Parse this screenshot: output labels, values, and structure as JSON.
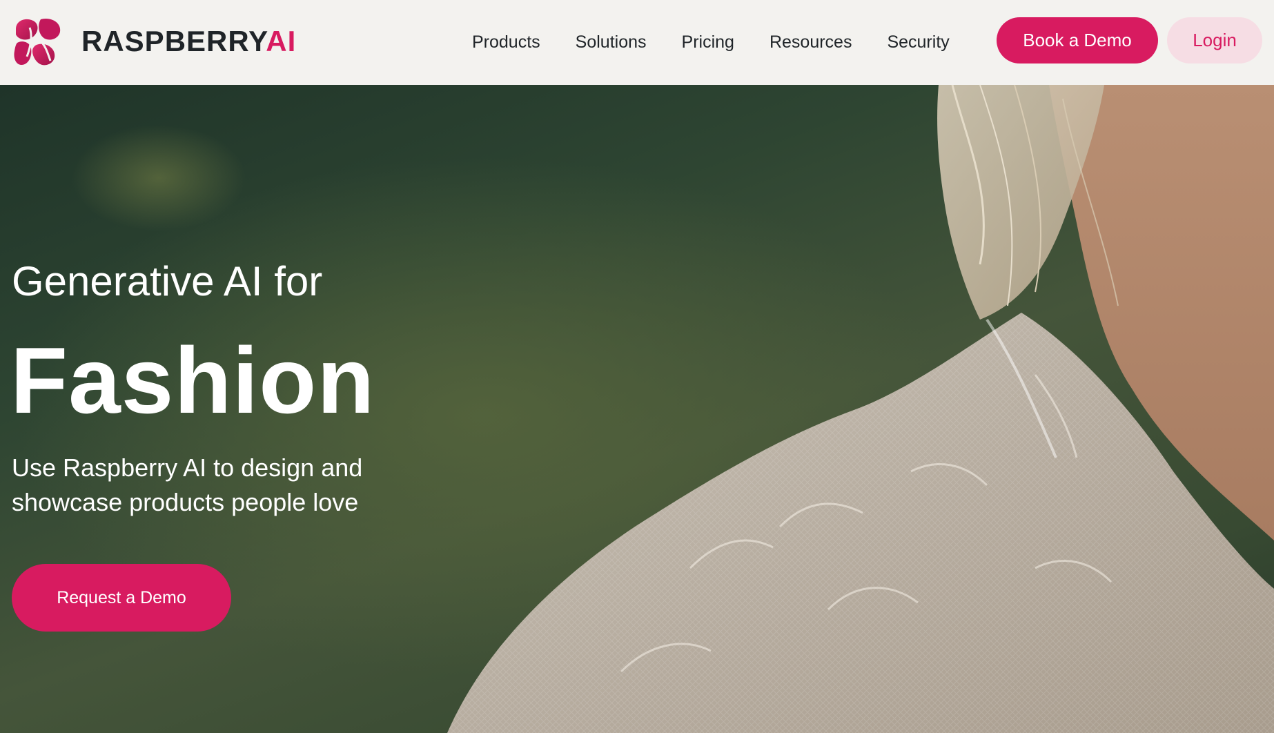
{
  "header": {
    "logo": {
      "text_main": "RASPBERRY",
      "text_accent": "AI"
    },
    "nav": [
      {
        "label": "Products"
      },
      {
        "label": "Solutions"
      },
      {
        "label": "Pricing"
      },
      {
        "label": "Resources"
      },
      {
        "label": "Security"
      }
    ],
    "book_demo_label": "Book a Demo",
    "login_label": "Login"
  },
  "hero": {
    "line1": "Generative AI for",
    "line2": "Fashion",
    "subtitle": "Use Raspberry AI to design and showcase products people love",
    "cta_label": "Request a Demo"
  },
  "colors": {
    "brand": "#d81b60",
    "login_bg": "#f6dde4",
    "header_bg": "#f3f2ef",
    "text_dark": "#1f2428"
  },
  "icons": {
    "logo_mark": "raspberry-r-logo-icon"
  }
}
